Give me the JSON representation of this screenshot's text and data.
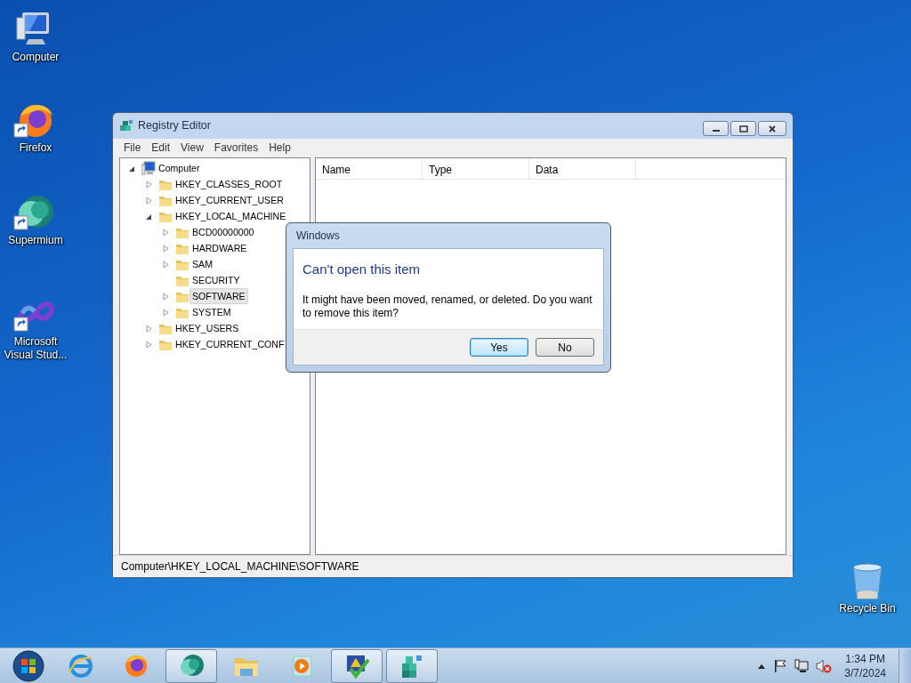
{
  "desktop_icons": [
    {
      "label": "Computer",
      "shortcut": false
    },
    {
      "label": "Firefox",
      "shortcut": true
    },
    {
      "label": "Supermium",
      "shortcut": true
    },
    {
      "label": "Microsoft Visual Stud...",
      "shortcut": true
    },
    {
      "label": "Recycle Bin",
      "shortcut": false
    }
  ],
  "registry_editor": {
    "title": "Registry Editor",
    "menu": [
      "File",
      "Edit",
      "View",
      "Favorites",
      "Help"
    ],
    "tree": [
      {
        "label": "Computer",
        "kind": "computer",
        "expandable": true,
        "expanded": true,
        "selected": false,
        "children": [
          {
            "label": "HKEY_CLASSES_ROOT",
            "kind": "folder",
            "expandable": true,
            "expanded": false,
            "selected": false
          },
          {
            "label": "HKEY_CURRENT_USER",
            "kind": "folder",
            "expandable": true,
            "expanded": false,
            "selected": false
          },
          {
            "label": "HKEY_LOCAL_MACHINE",
            "kind": "folder",
            "expandable": true,
            "expanded": true,
            "selected": false,
            "children": [
              {
                "label": "BCD00000000",
                "kind": "folder",
                "expandable": true,
                "expanded": false,
                "selected": false
              },
              {
                "label": "HARDWARE",
                "kind": "folder",
                "expandable": true,
                "expanded": false,
                "selected": false
              },
              {
                "label": "SAM",
                "kind": "folder",
                "expandable": true,
                "expanded": false,
                "selected": false
              },
              {
                "label": "SECURITY",
                "kind": "folder",
                "expandable": false,
                "selected": false
              },
              {
                "label": "SOFTWARE",
                "kind": "folder",
                "expandable": true,
                "expanded": false,
                "selected": true
              },
              {
                "label": "SYSTEM",
                "kind": "folder",
                "expandable": true,
                "expanded": false,
                "selected": false
              }
            ]
          },
          {
            "label": "HKEY_USERS",
            "kind": "folder",
            "expandable": true,
            "expanded": false,
            "selected": false
          },
          {
            "label": "HKEY_CURRENT_CONF",
            "kind": "folder",
            "expandable": true,
            "expanded": false,
            "selected": false
          }
        ]
      }
    ],
    "columns": [
      "Name",
      "Type",
      "Data"
    ],
    "status_bar": "Computer\\HKEY_LOCAL_MACHINE\\SOFTWARE"
  },
  "dialog": {
    "title": "Windows",
    "heading": "Can't open this item",
    "message": "It might have been moved, renamed, or deleted. Do you want to remove this item?",
    "buttons": [
      {
        "label": "Yes",
        "default": true
      },
      {
        "label": "No",
        "default": false
      }
    ]
  },
  "taskbar": {
    "items": [
      {
        "running": false
      },
      {
        "running": false
      },
      {
        "running": true
      },
      {
        "running": false
      },
      {
        "running": false
      },
      {
        "running": true
      },
      {
        "running": true
      }
    ],
    "time": "1:34 PM",
    "date": "3/7/2024"
  }
}
